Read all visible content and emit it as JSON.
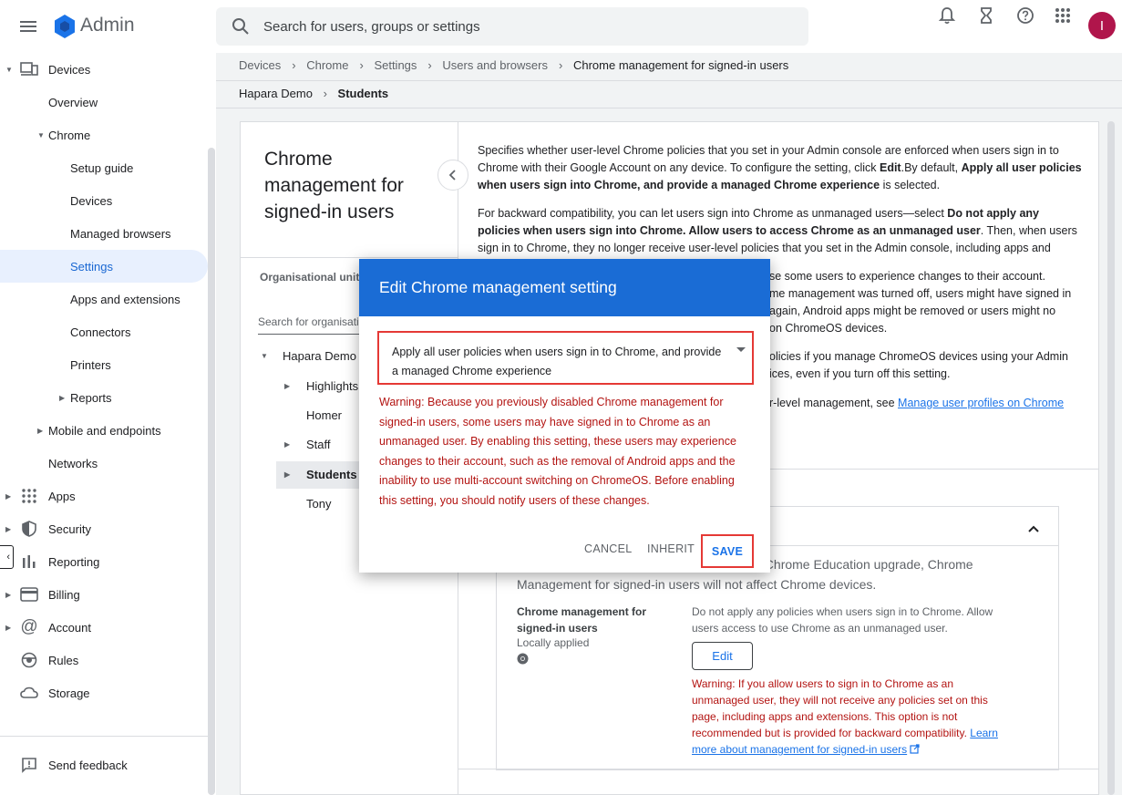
{
  "topbar": {
    "brand": "Admin",
    "search_placeholder": "Search for users, groups or settings",
    "avatar_letter": "I"
  },
  "sidebar": {
    "items": [
      {
        "label": "Devices"
      },
      {
        "label": "Overview"
      },
      {
        "label": "Chrome"
      },
      {
        "label": "Setup guide"
      },
      {
        "label": "Devices"
      },
      {
        "label": "Managed browsers"
      },
      {
        "label": "Settings"
      },
      {
        "label": "Apps and extensions"
      },
      {
        "label": "Connectors"
      },
      {
        "label": "Printers"
      },
      {
        "label": "Reports"
      },
      {
        "label": "Mobile and endpoints"
      },
      {
        "label": "Networks"
      },
      {
        "label": "Apps"
      },
      {
        "label": "Security"
      },
      {
        "label": "Reporting"
      },
      {
        "label": "Billing"
      },
      {
        "label": "Account"
      },
      {
        "label": "Rules"
      },
      {
        "label": "Storage"
      }
    ],
    "feedback": "Send feedback"
  },
  "breadcrumb": [
    "Devices",
    "Chrome",
    "Settings",
    "Users and browsers",
    "Chrome management for signed-in users"
  ],
  "ou_bar": {
    "parent": "Hapara Demo",
    "current": "Students"
  },
  "left_panel": {
    "title": "Chrome management for signed-in users",
    "ou_label": "Organisational units",
    "search_placeholder": "Search for organisational units",
    "tree": [
      "Hapara Demo",
      "Highlights",
      "Homer",
      "Staff",
      "Students",
      "Tony"
    ]
  },
  "description": {
    "p1_a": "Specifies whether user-level Chrome policies that you set in your Admin console are enforced when users sign in to Chrome with their Google Account on any device. To configure the setting, click ",
    "p1_b": "Edit",
    "p1_c": ".By default, ",
    "p1_d": "Apply all user policies when users sign into Chrome, and provide a managed Chrome experience",
    "p1_e": " is selected.",
    "p2_a": "For backward compatibility, you can let users sign into Chrome as unmanaged users—select ",
    "p2_b": "Do not apply any policies when users sign into Chrome. Allow users to access Chrome as an unmanaged user",
    "p2_c": ". Then, when users sign in to Chrome, they no longer receive user-level policies that you set in the Admin console, including apps and extensions.",
    "p3_a": "se some users to experience changes to their account.",
    "p3_b": "me management was turned off, users might have signed in",
    "p3_c": "again, Android apps might be removed or users might no",
    "p3_d": " on ChromeOS devices.",
    "p4_a": "olicies if you manage ChromeOS devices using your Admin",
    "p4_b": "ices, even if you turn off this setting.",
    "p5_a": "r-level management, see ",
    "p5_link": "Manage user profiles on Chrome"
  },
  "setting": {
    "note_a": "de or Chrome Education upgrade, Chrome",
    "note_b": "Management for signed-in users will not affect Chrome devices.",
    "name": "Chrome management for signed-in users",
    "sub": "Locally applied",
    "value": "Do not apply any policies when users sign in to Chrome. Allow users access to use Chrome as an unmanaged user.",
    "edit_label": "Edit",
    "warning": "Warning: If you allow users to sign in to Chrome as an unmanaged user, they will not receive any policies set on this page, including apps and extensions. This option is not recommended but is provided for backward compatibility.",
    "learn_more": "Learn more about management for signed-in users"
  },
  "dialog": {
    "title": "Edit Chrome management setting",
    "selected_option": "Apply all user policies when users sign in to Chrome, and provide a managed Chrome experience",
    "warning": "Warning: Because you previously disabled Chrome management for signed-in users, some users may have signed in to Chrome as an unmanaged user. By enabling this setting, these users may experience changes to their account, such as the removal of Android apps and the inability to use multi-account switching on ChromeOS. Before enabling this setting, you should notify users of these changes.",
    "cancel": "CANCEL",
    "inherit": "INHERIT",
    "save": "SAVE"
  },
  "colors": {
    "header_blue": "#1a6cd5",
    "warning_red": "#b31412",
    "highlight_red": "#e53935",
    "link_blue": "#1a73e8",
    "avatar": "#b0154b"
  },
  "icons": [
    "menu-icon",
    "admin-logo-icon",
    "search-icon",
    "bell-icon",
    "hourglass-icon",
    "help-icon",
    "apps-grid-icon",
    "devices-icon",
    "security-shield-icon",
    "reporting-bars-icon",
    "billing-card-icon",
    "account-at-icon",
    "rules-icon",
    "storage-cloud-icon",
    "feedback-icon",
    "chevron-left-icon",
    "chevron-up-icon",
    "chrome-icon",
    "external-link-icon"
  ]
}
